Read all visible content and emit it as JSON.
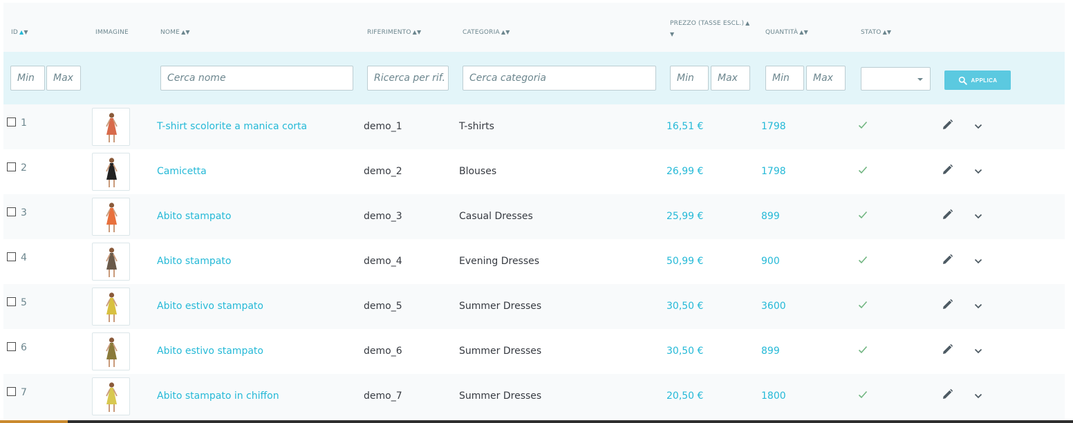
{
  "columns": {
    "id": "ID",
    "image": "IMMAGINE",
    "name": "NOME",
    "reference": "RIFERIMENTO",
    "category": "CATEGORIA",
    "price": "PREZZO (TASSE ESCL.)",
    "quantity": "QUANTITÀ",
    "status": "STATO"
  },
  "filters": {
    "id_min": "Min",
    "id_max": "Max",
    "name": "Cerca nome",
    "reference": "Ricerca per rif.",
    "category": "Cerca categoria",
    "price_min": "Min",
    "price_max": "Max",
    "qty_min": "Min",
    "qty_max": "Max",
    "status_selected": "",
    "apply": "APPLICA"
  },
  "rows": [
    {
      "id": "1",
      "name": "T-shirt scolorite a manica corta",
      "ref": "demo_1",
      "category": "T-shirts",
      "price": "16,51 €",
      "qty": "1798",
      "active": true
    },
    {
      "id": "2",
      "name": "Camicetta",
      "ref": "demo_2",
      "category": "Blouses",
      "price": "26,99 €",
      "qty": "1798",
      "active": true
    },
    {
      "id": "3",
      "name": "Abito stampato",
      "ref": "demo_3",
      "category": "Casual Dresses",
      "price": "25,99 €",
      "qty": "899",
      "active": true
    },
    {
      "id": "4",
      "name": "Abito stampato",
      "ref": "demo_4",
      "category": "Evening Dresses",
      "price": "50,99 €",
      "qty": "900",
      "active": true
    },
    {
      "id": "5",
      "name": "Abito estivo stampato",
      "ref": "demo_5",
      "category": "Summer Dresses",
      "price": "30,50 €",
      "qty": "3600",
      "active": true
    },
    {
      "id": "6",
      "name": "Abito estivo stampato",
      "ref": "demo_6",
      "category": "Summer Dresses",
      "price": "30,50 €",
      "qty": "899",
      "active": true
    },
    {
      "id": "7",
      "name": "Abito stampato in chiffon",
      "ref": "demo_7",
      "category": "Summer Dresses",
      "price": "20,50 €",
      "qty": "1800",
      "active": true
    }
  ],
  "thumb_colors": [
    "#d86a4a",
    "#222222",
    "#e8703c",
    "#6a5a4a",
    "#d8c040",
    "#8a7a3a",
    "#d8c850"
  ],
  "colors": {
    "link": "#25b9d7",
    "check": "#70b580",
    "filter_bg": "#e3f5f9",
    "apply_button": "#5bc9e0"
  },
  "icons": {
    "apply": "search-icon",
    "status": "check-icon",
    "edit": "pencil-icon",
    "more": "chevron-down-icon"
  }
}
